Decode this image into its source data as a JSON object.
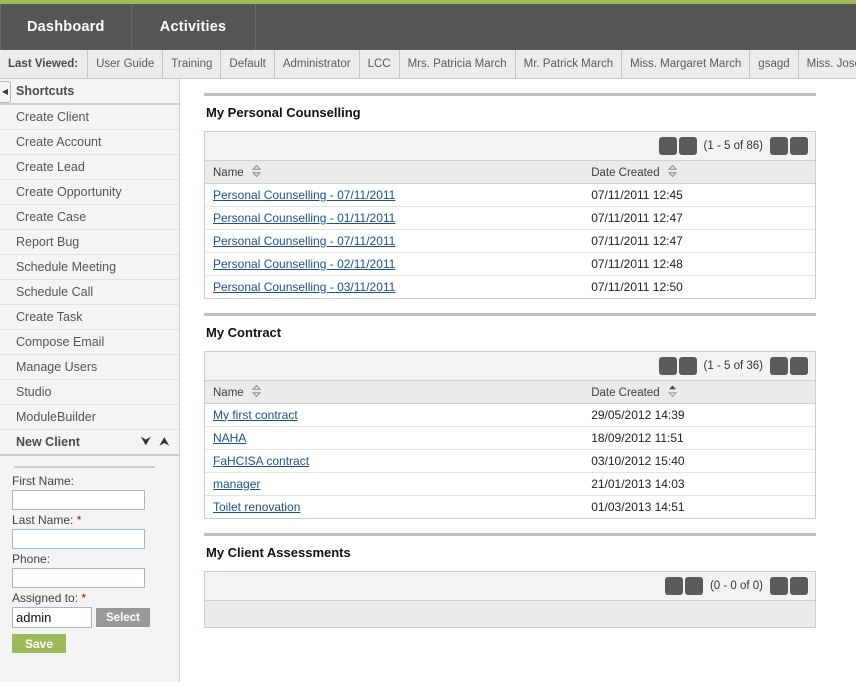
{
  "theme": {
    "accent_green": "#9cbb58",
    "nav_background": "#565656",
    "link_color": "#1c4f9c",
    "required_marker": "#cc0000"
  },
  "navbar": {
    "tabs": [
      {
        "label": "Dashboard",
        "active": true
      },
      {
        "label": "Activities",
        "active": false
      }
    ]
  },
  "last_viewed": {
    "label": "Last Viewed:",
    "items": [
      {
        "label": "User Guide"
      },
      {
        "label": "Training"
      },
      {
        "label": "Default"
      },
      {
        "label": "Administrator"
      },
      {
        "label": "LCC"
      },
      {
        "label": "Mrs. Patricia March"
      },
      {
        "label": "Mr. Patrick March"
      },
      {
        "label": "Miss. Margaret March"
      },
      {
        "label": "gsagd"
      },
      {
        "label": "Miss. Josephine"
      }
    ]
  },
  "sidebar": {
    "collapse_icon": "chevron-left-icon",
    "shortcuts": {
      "title": "Shortcuts",
      "items": [
        {
          "label": "Create Client"
        },
        {
          "label": "Create Account"
        },
        {
          "label": "Create Lead"
        },
        {
          "label": "Create Opportunity"
        },
        {
          "label": "Create Case"
        },
        {
          "label": "Report Bug"
        },
        {
          "label": "Schedule Meeting"
        },
        {
          "label": "Schedule Call"
        },
        {
          "label": "Create Task"
        },
        {
          "label": "Compose Email"
        },
        {
          "label": "Manage Users"
        },
        {
          "label": "Studio"
        },
        {
          "label": "ModuleBuilder"
        }
      ]
    },
    "new_client": {
      "title": "New Client",
      "collapse_all_icon": "double-chevron-down-icon",
      "expand_all_icon": "double-chevron-up-icon",
      "fields": [
        {
          "label": "First Name:",
          "required": false,
          "value": "",
          "placeholder": ""
        },
        {
          "label": "Last Name:",
          "required": true,
          "value": "",
          "placeholder": ""
        },
        {
          "label": "Phone:",
          "required": false,
          "value": "",
          "placeholder": ""
        }
      ],
      "assigned_to": {
        "label": "Assigned to:",
        "required": true,
        "value": "admin",
        "select_button": "Select"
      },
      "save_button": "Save"
    }
  },
  "dashboard": {
    "sections": [
      {
        "title": "My Personal Counselling",
        "pagination": {
          "start_icon": "page-start-icon",
          "prev_icon": "page-prev-icon",
          "count": "(1 - 5 of 86)",
          "next_icon": "page-next-icon",
          "end_icon": "page-end-icon"
        },
        "columns": [
          {
            "label": "Name",
            "sort": "none"
          },
          {
            "label": "Date Created",
            "sort": "none"
          }
        ],
        "rows": [
          {
            "name": "Personal Counselling - 07/11/2011",
            "date_created": "07/11/2011 12:45"
          },
          {
            "name": "Personal Counselling - 01/11/2011",
            "date_created": "07/11/2011 12:47"
          },
          {
            "name": "Personal Counselling - 07/11/2011",
            "date_created": "07/11/2011 12:47"
          },
          {
            "name": "Personal Counselling - 02/11/2011",
            "date_created": "07/11/2011 12:48"
          },
          {
            "name": "Personal Counselling - 03/11/2011",
            "date_created": "07/11/2011 12:50"
          }
        ]
      },
      {
        "title": "My Contract",
        "pagination": {
          "start_icon": "page-start-icon",
          "prev_icon": "page-prev-icon",
          "count": "(1 - 5 of 36)",
          "next_icon": "page-next-icon",
          "end_icon": "page-end-icon"
        },
        "columns": [
          {
            "label": "Name",
            "sort": "none"
          },
          {
            "label": "Date Created",
            "sort": "asc"
          }
        ],
        "rows": [
          {
            "name": "My first contract",
            "date_created": "29/05/2012 14:39"
          },
          {
            "name": "NAHA",
            "date_created": "18/09/2012 11:51"
          },
          {
            "name": "FaHCISA contract",
            "date_created": "03/10/2012 15:40"
          },
          {
            "name": "manager",
            "date_created": "21/01/2013 14:03"
          },
          {
            "name": "Toilet renovation",
            "date_created": "01/03/2013 14:51"
          }
        ]
      },
      {
        "title": "My Client Assessments",
        "pagination": {
          "start_icon": "page-start-icon",
          "prev_icon": "page-prev-icon",
          "count": "(0 - 0 of 0)",
          "next_icon": "page-next-icon",
          "end_icon": "page-end-icon"
        },
        "columns": [],
        "rows": []
      }
    ]
  }
}
